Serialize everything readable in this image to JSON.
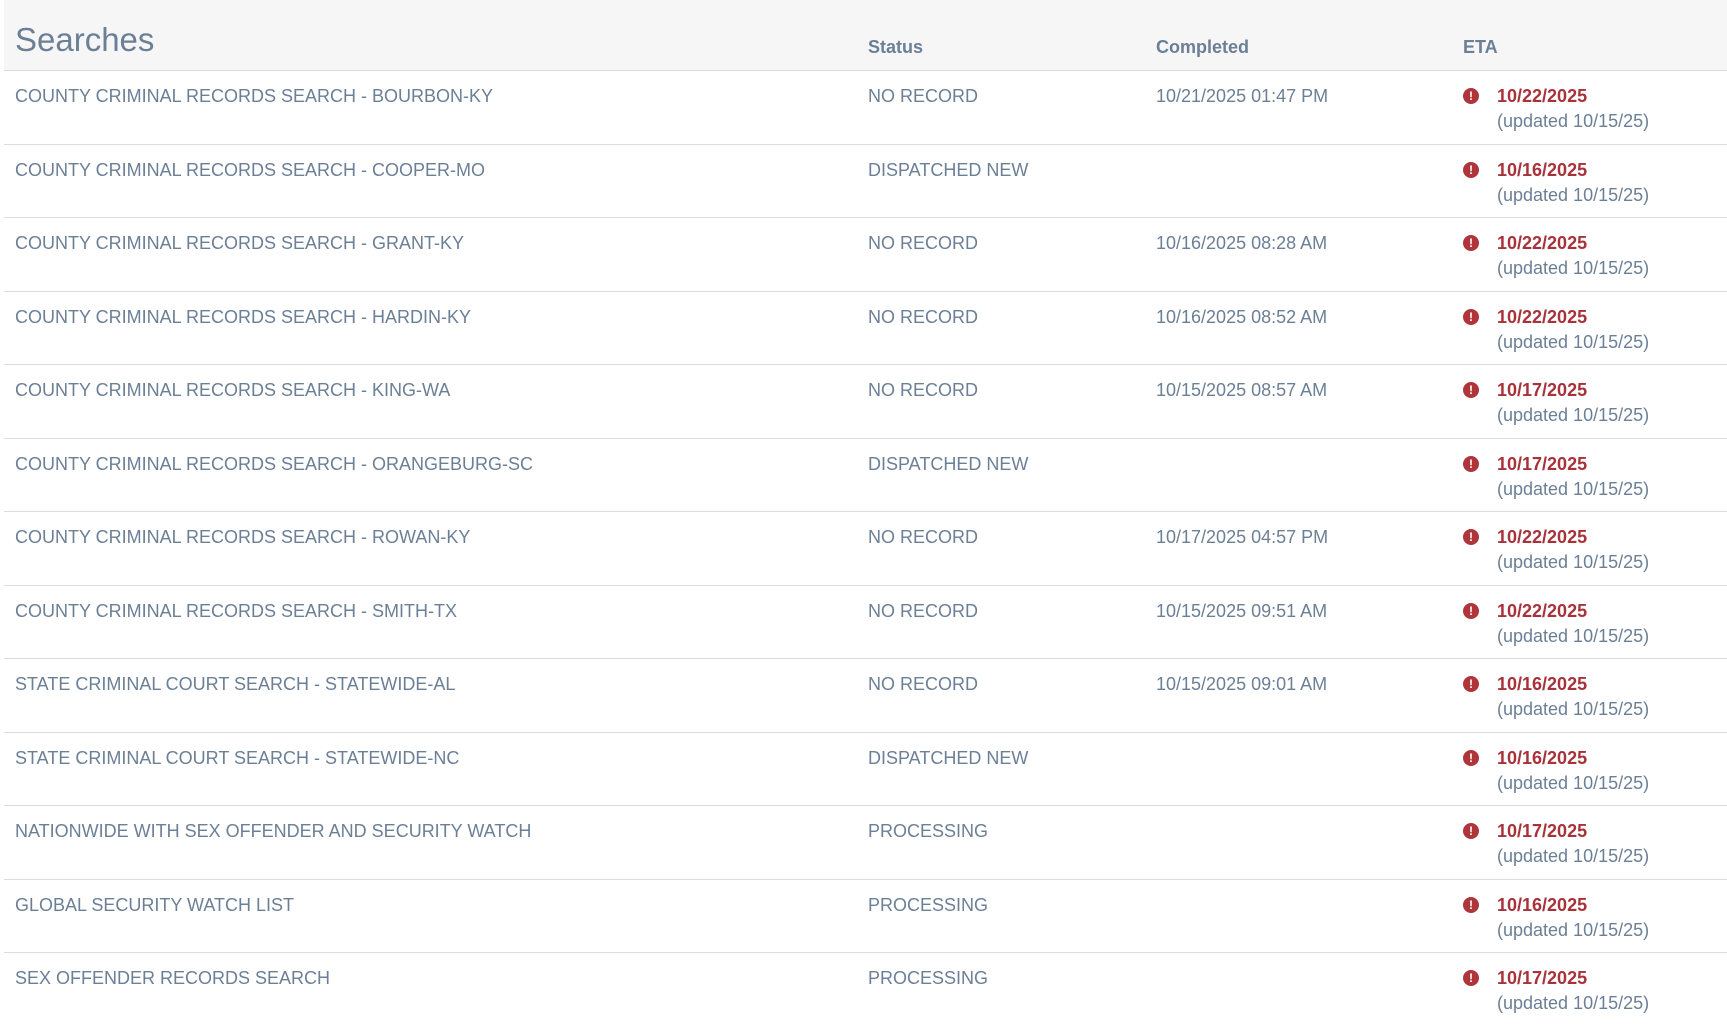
{
  "header": {
    "title": "Searches",
    "columns": {
      "status": "Status",
      "completed": "Completed",
      "eta": "ETA"
    }
  },
  "colors": {
    "text": "#6b7f96",
    "alert": "#a8323a",
    "header_bg": "#f6f6f6"
  },
  "alert_icon": {
    "name": "exclamation-circle-icon",
    "glyph": "!"
  },
  "rows": [
    {
      "name": "COUNTY CRIMINAL RECORDS SEARCH - BOURBON-KY",
      "status": "NO RECORD",
      "completed": "10/21/2025 01:47 PM",
      "eta": "10/22/2025",
      "updated": "(updated 10/15/25)"
    },
    {
      "name": "COUNTY CRIMINAL RECORDS SEARCH - COOPER-MO",
      "status": "DISPATCHED NEW",
      "completed": "",
      "eta": "10/16/2025",
      "updated": "(updated 10/15/25)"
    },
    {
      "name": "COUNTY CRIMINAL RECORDS SEARCH - GRANT-KY",
      "status": "NO RECORD",
      "completed": "10/16/2025 08:28 AM",
      "eta": "10/22/2025",
      "updated": "(updated 10/15/25)"
    },
    {
      "name": "COUNTY CRIMINAL RECORDS SEARCH - HARDIN-KY",
      "status": "NO RECORD",
      "completed": "10/16/2025 08:52 AM",
      "eta": "10/22/2025",
      "updated": "(updated 10/15/25)"
    },
    {
      "name": "COUNTY CRIMINAL RECORDS SEARCH - KING-WA",
      "status": "NO RECORD",
      "completed": "10/15/2025 08:57 AM",
      "eta": "10/17/2025",
      "updated": "(updated 10/15/25)"
    },
    {
      "name": "COUNTY CRIMINAL RECORDS SEARCH - ORANGEBURG-SC",
      "status": "DISPATCHED NEW",
      "completed": "",
      "eta": "10/17/2025",
      "updated": "(updated 10/15/25)"
    },
    {
      "name": "COUNTY CRIMINAL RECORDS SEARCH - ROWAN-KY",
      "status": "NO RECORD",
      "completed": "10/17/2025 04:57 PM",
      "eta": "10/22/2025",
      "updated": "(updated 10/15/25)"
    },
    {
      "name": "COUNTY CRIMINAL RECORDS SEARCH - SMITH-TX",
      "status": "NO RECORD",
      "completed": "10/15/2025 09:51 AM",
      "eta": "10/22/2025",
      "updated": "(updated 10/15/25)"
    },
    {
      "name": "STATE CRIMINAL COURT SEARCH - STATEWIDE-AL",
      "status": "NO RECORD",
      "completed": "10/15/2025 09:01 AM",
      "eta": "10/16/2025",
      "updated": "(updated 10/15/25)"
    },
    {
      "name": "STATE CRIMINAL COURT SEARCH - STATEWIDE-NC",
      "status": "DISPATCHED NEW",
      "completed": "",
      "eta": "10/16/2025",
      "updated": "(updated 10/15/25)"
    },
    {
      "name": "NATIONWIDE WITH SEX OFFENDER AND SECURITY WATCH",
      "status": "PROCESSING",
      "completed": "",
      "eta": "10/17/2025",
      "updated": "(updated 10/15/25)"
    },
    {
      "name": "GLOBAL SECURITY WATCH LIST",
      "status": "PROCESSING",
      "completed": "",
      "eta": "10/16/2025",
      "updated": "(updated 10/15/25)"
    },
    {
      "name": "SEX OFFENDER RECORDS SEARCH",
      "status": "PROCESSING",
      "completed": "",
      "eta": "10/17/2025",
      "updated": "(updated 10/15/25)"
    }
  ]
}
